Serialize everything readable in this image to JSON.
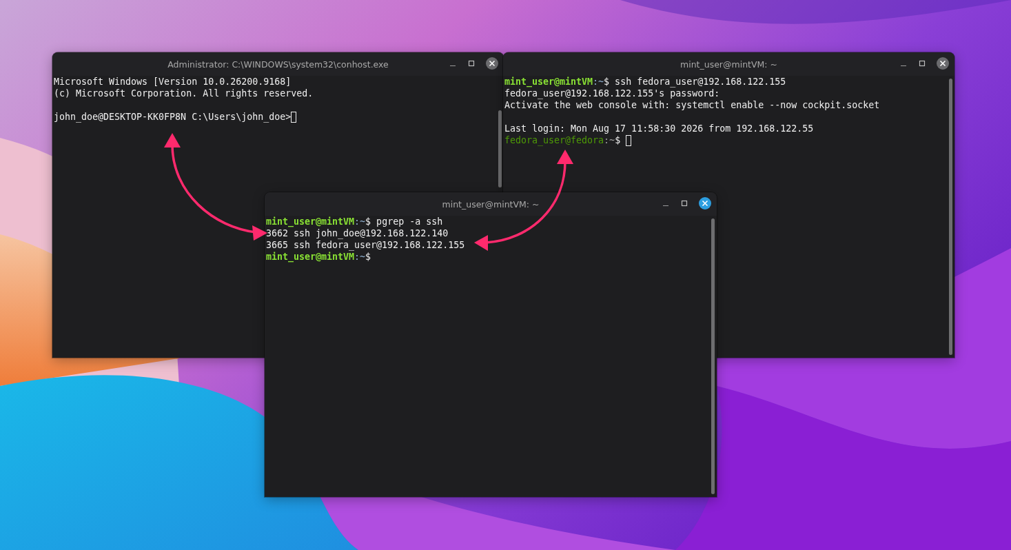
{
  "windows": [
    {
      "title": "Administrator: C:\\WINDOWS\\system32\\conhost.exe",
      "active": false,
      "lines": [
        {
          "segments": [
            {
              "kind": "text",
              "text": "Microsoft Windows [Version 10.0.26200.9168]"
            }
          ]
        },
        {
          "segments": [
            {
              "kind": "text",
              "text": "(c) Microsoft Corporation. All rights reserved."
            }
          ]
        },
        {
          "kind": "blank"
        },
        {
          "segments": [
            {
              "kind": "text",
              "text": "john_doe@DESKTOP-KK0FP8N C:\\Users\\john_doe>"
            },
            {
              "kind": "cursor"
            }
          ]
        }
      ]
    },
    {
      "title": "mint_user@mintVM: ~",
      "active": false,
      "lines": [
        {
          "segments": [
            {
              "kind": "prompt",
              "text": "mint_user@mintVM"
            },
            {
              "kind": "path",
              "text": ":~"
            },
            {
              "kind": "text",
              "text": "$ ssh fedora_user@192.168.122.155"
            }
          ]
        },
        {
          "segments": [
            {
              "kind": "text",
              "text": "fedora_user@192.168.122.155's password:"
            }
          ]
        },
        {
          "segments": [
            {
              "kind": "text",
              "text": "Activate the web console with: systemctl enable --now cockpit.socket"
            }
          ]
        },
        {
          "kind": "blank"
        },
        {
          "segments": [
            {
              "kind": "text",
              "text": "Last login: Mon Aug 17 11:58:30 2026 from 192.168.122.55"
            }
          ]
        },
        {
          "segments": [
            {
              "kind": "remote_prompt",
              "text": "fedora_user@fedora"
            },
            {
              "kind": "remote_path",
              "text": ":~"
            },
            {
              "kind": "text",
              "text": "$ "
            },
            {
              "kind": "cursor"
            }
          ]
        }
      ]
    },
    {
      "title": "mint_user@mintVM: ~",
      "active": true,
      "lines": [
        {
          "segments": [
            {
              "kind": "prompt",
              "text": "mint_user@mintVM"
            },
            {
              "kind": "path",
              "text": ":~"
            },
            {
              "kind": "text",
              "text": "$ pgrep -a ssh"
            }
          ]
        },
        {
          "segments": [
            {
              "kind": "text",
              "text": "3662 ssh john_doe@192.168.122.140"
            }
          ]
        },
        {
          "segments": [
            {
              "kind": "text",
              "text": "3665 ssh fedora_user@192.168.122.155"
            }
          ]
        },
        {
          "segments": [
            {
              "kind": "prompt",
              "text": "mint_user@mintVM"
            },
            {
              "kind": "path",
              "text": ":~"
            },
            {
              "kind": "text",
              "text": "$"
            }
          ]
        }
      ]
    }
  ]
}
